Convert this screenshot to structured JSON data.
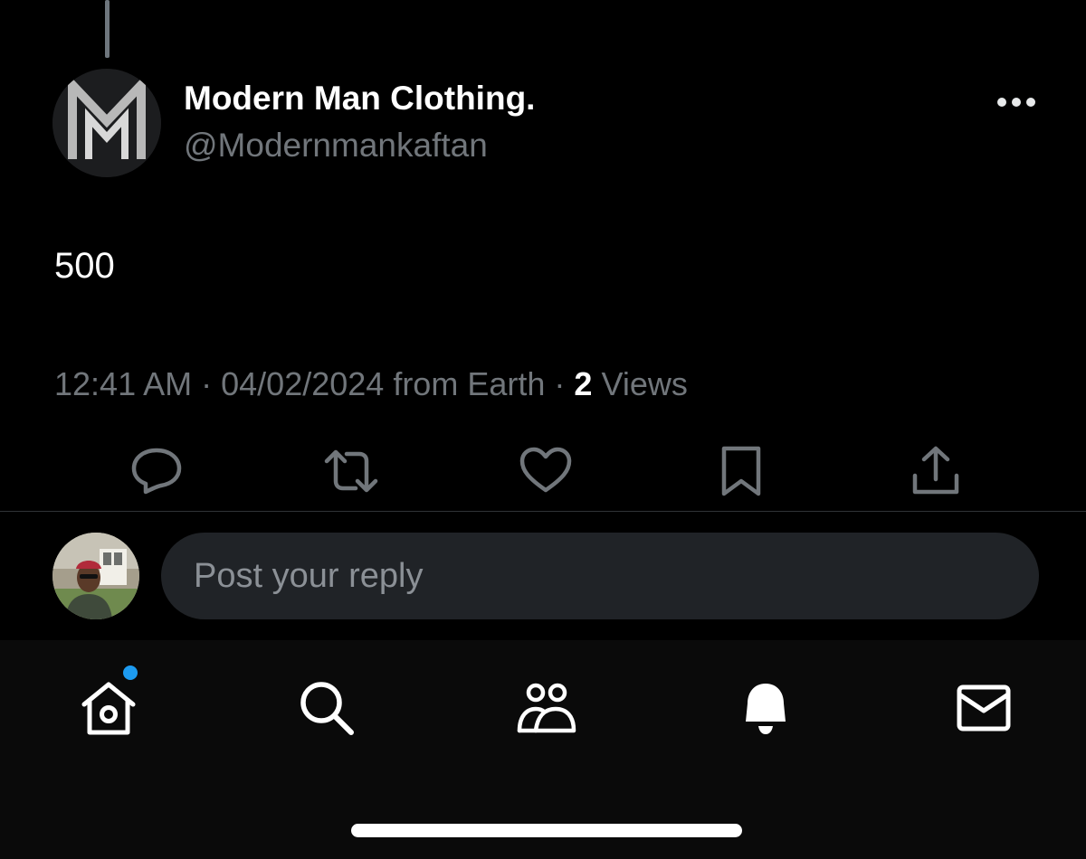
{
  "post": {
    "author_name": "Modern Man Clothing.",
    "author_handle": "@Modernmankaftan",
    "avatar_icon": "modern-man-logo-icon",
    "text": "500",
    "time": "12:41 AM",
    "separator": "·",
    "date_source": "04/02/2024 from Earth",
    "views_count": "2",
    "views_label": "Views"
  },
  "actions": [
    {
      "name": "reply",
      "icon": "comment-icon"
    },
    {
      "name": "repost",
      "icon": "repost-icon"
    },
    {
      "name": "like",
      "icon": "heart-icon"
    },
    {
      "name": "bookmark",
      "icon": "bookmark-icon"
    },
    {
      "name": "share",
      "icon": "share-icon"
    }
  ],
  "reply": {
    "placeholder": "Post your reply"
  },
  "tabbar": [
    {
      "name": "home",
      "icon": "home-icon",
      "has_notification_dot": true
    },
    {
      "name": "search",
      "icon": "search-icon"
    },
    {
      "name": "communities",
      "icon": "people-icon"
    },
    {
      "name": "notifications",
      "icon": "bell-icon"
    },
    {
      "name": "messages",
      "icon": "mail-icon"
    }
  ],
  "colors": {
    "background": "#000000",
    "text_primary": "#ffffff",
    "text_secondary": "#71767b",
    "input_background": "#202327",
    "accent": "#1d9bf0"
  }
}
